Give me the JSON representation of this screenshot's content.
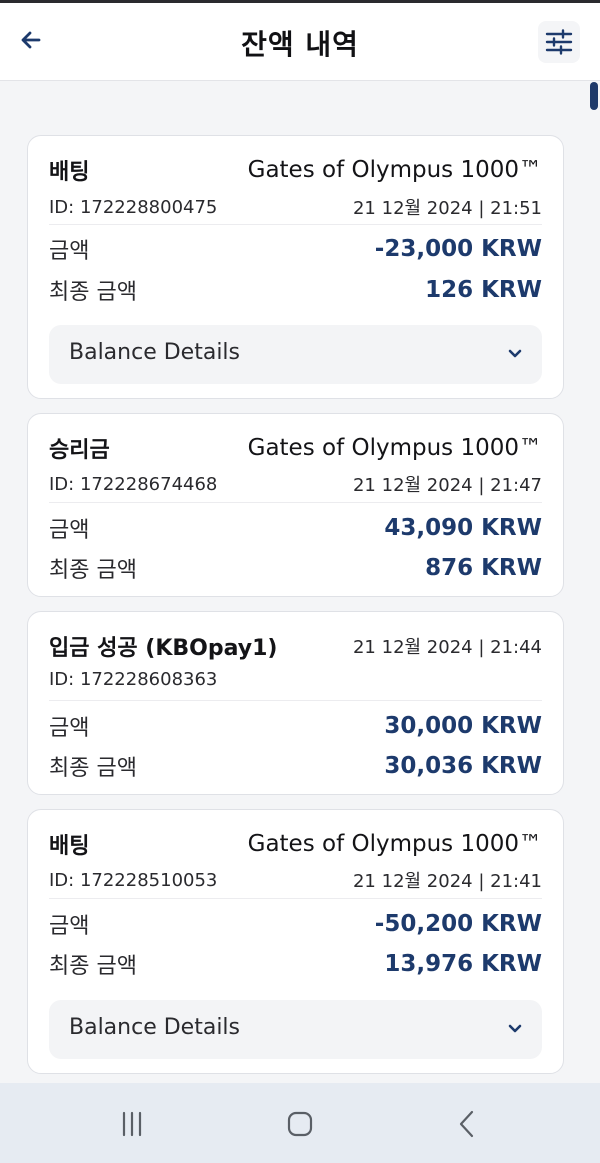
{
  "header": {
    "title": "잔액 내역"
  },
  "cards": [
    {
      "type": "배팅",
      "game": "Gates of Olympus 1000™",
      "id": "ID: 172228800475",
      "datetime": "21 12월 2024 | 21:51",
      "amount_label": "금액",
      "amount": "-23,000 KRW",
      "final_label": "최종 금액",
      "final": "126 KRW",
      "details_label": "Balance Details"
    },
    {
      "type": "승리금",
      "game": "Gates of Olympus 1000™",
      "id": "ID: 172228674468",
      "datetime": "21 12월 2024 | 21:47",
      "amount_label": "금액",
      "amount": "43,090 KRW",
      "final_label": "최종 금액",
      "final": "876 KRW"
    },
    {
      "type": "입금 성공 (KBOpay1)",
      "id": "ID: 172228608363",
      "datetime": "21 12월 2024 | 21:44",
      "amount_label": "금액",
      "amount": "30,000 KRW",
      "final_label": "최종 금액",
      "final": "30,036 KRW"
    },
    {
      "type": "배팅",
      "game": "Gates of Olympus 1000™",
      "id": "ID: 172228510053",
      "datetime": "21 12월 2024 | 21:41",
      "amount_label": "금액",
      "amount": "-50,200 KRW",
      "final_label": "최종 금액",
      "final": "13,976 KRW",
      "details_label": "Balance Details"
    }
  ],
  "icons": {
    "back": "arrow-left-icon",
    "filter": "sliders-icon",
    "expand": "chevron-down-icon",
    "nav_recents": "recents-icon",
    "nav_home": "home-icon",
    "nav_back": "nav-back-icon"
  },
  "colors": {
    "accent": "#1d3a6c",
    "background": "#f4f5f7",
    "card": "#ffffff",
    "navbar": "#e6ebf2"
  }
}
